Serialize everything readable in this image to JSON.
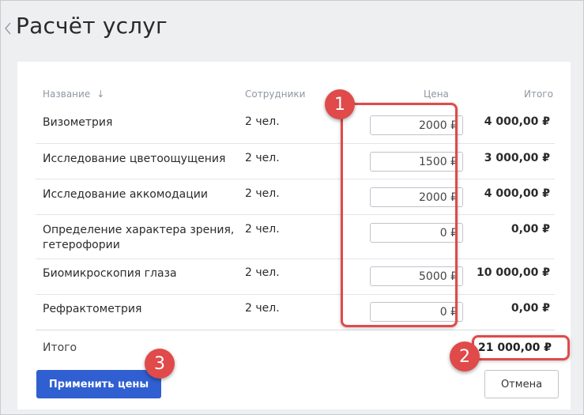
{
  "page": {
    "title": "Расчёт услуг"
  },
  "table": {
    "headers": {
      "name": "Название",
      "sort_icon": "↓",
      "employees": "Сотрудники",
      "price": "Цена",
      "total": "Итого"
    },
    "rows": [
      {
        "name": "Визометрия",
        "employees": "2 чел.",
        "price": "2000 ₽",
        "total": "4 000,00 ₽"
      },
      {
        "name": "Исследование цветоощущения",
        "employees": "2 чел.",
        "price": "1500 ₽",
        "total": "3 000,00 ₽"
      },
      {
        "name": "Исследование аккомодации",
        "employees": "2 чел.",
        "price": "2000 ₽",
        "total": "4 000,00 ₽"
      },
      {
        "name": "Определение характера зрения, гетерофории",
        "employees": "2 чел.",
        "price": "0 ₽",
        "total": "0,00 ₽"
      },
      {
        "name": "Биомикроскопия глаза",
        "employees": "2 чел.",
        "price": "5000 ₽",
        "total": "10 000,00 ₽"
      },
      {
        "name": "Рефрактометрия",
        "employees": "2 чел.",
        "price": "0 ₽",
        "total": "0,00 ₽"
      }
    ],
    "footer": {
      "label": "Итого",
      "grand_total": "21 000,00 ₽"
    }
  },
  "buttons": {
    "apply": "Применить цены",
    "cancel": "Отмена"
  },
  "annotations": {
    "badge_1": "1",
    "badge_2": "2",
    "badge_3": "3"
  },
  "colors": {
    "accent": "#2f5fd0",
    "highlight": "#e04a4a",
    "header_text": "#8f97a3"
  },
  "icons": {
    "back": "chevron-left-icon",
    "sort": "arrow-down-icon"
  }
}
